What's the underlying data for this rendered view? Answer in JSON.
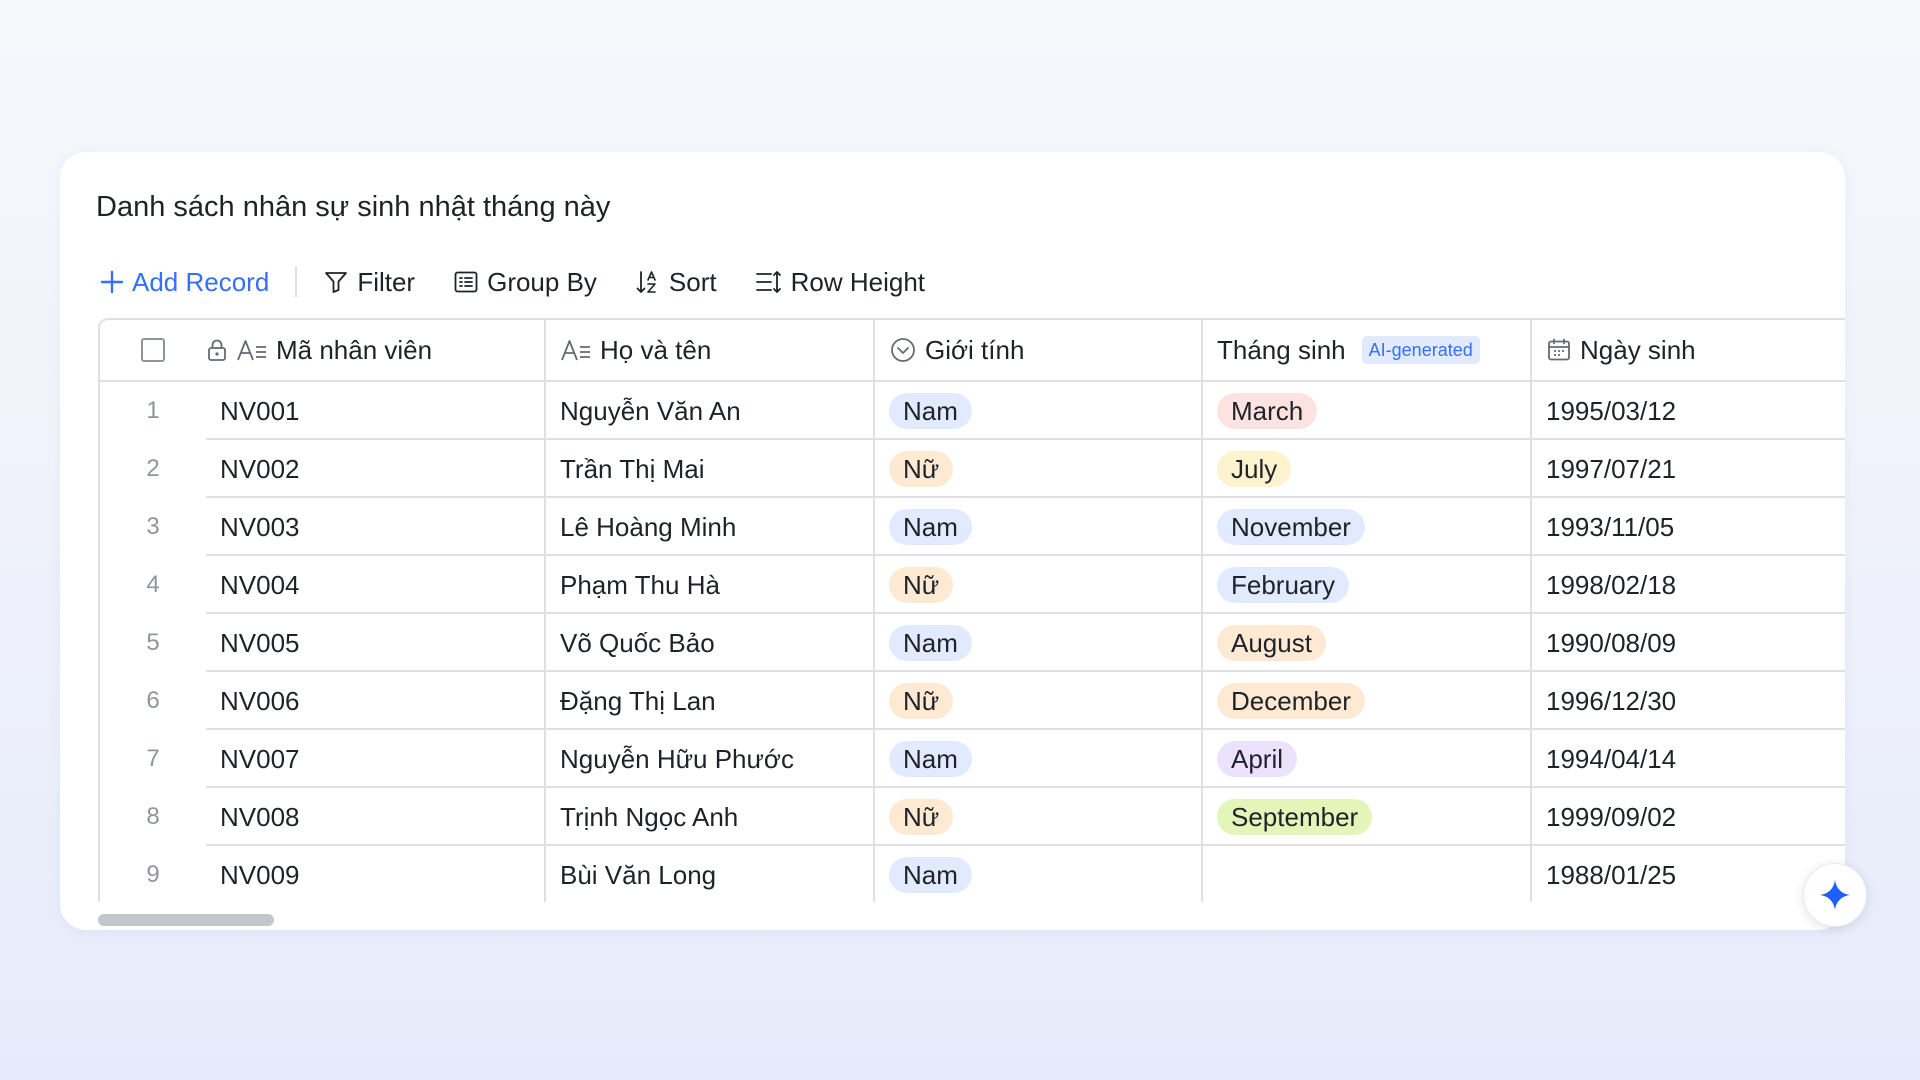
{
  "title": "Danh sách nhân sự sinh nhật tháng này",
  "toolbar": {
    "add_record": "Add Record",
    "filter": "Filter",
    "group_by": "Group By",
    "sort": "Sort",
    "row_height": "Row Height"
  },
  "columns": {
    "code": "Mã nhân viên",
    "name": "Họ và tên",
    "gender": "Giới tính",
    "month": "Tháng sinh",
    "month_badge": "AI-generated",
    "date": "Ngày sinh"
  },
  "rows": [
    {
      "num": "1",
      "code": "NV001",
      "name": "Nguyễn Văn An",
      "gender": "Nam",
      "month": "March",
      "date": "1995/03/12"
    },
    {
      "num": "2",
      "code": "NV002",
      "name": "Trần Thị Mai",
      "gender": "Nữ",
      "month": "July",
      "date": "1997/07/21"
    },
    {
      "num": "3",
      "code": "NV003",
      "name": "Lê Hoàng Minh",
      "gender": "Nam",
      "month": "November",
      "date": "1993/11/05"
    },
    {
      "num": "4",
      "code": "NV004",
      "name": "Phạm Thu Hà",
      "gender": "Nữ",
      "month": "February",
      "date": "1998/02/18"
    },
    {
      "num": "5",
      "code": "NV005",
      "name": "Võ Quốc Bảo",
      "gender": "Nam",
      "month": "August",
      "date": "1990/08/09"
    },
    {
      "num": "6",
      "code": "NV006",
      "name": "Đặng Thị Lan",
      "gender": "Nữ",
      "month": "December",
      "date": "1996/12/30"
    },
    {
      "num": "7",
      "code": "NV007",
      "name": "Nguyễn Hữu Phước",
      "gender": "Nam",
      "month": "April",
      "date": "1994/04/14"
    },
    {
      "num": "8",
      "code": "NV008",
      "name": "Trịnh Ngọc Anh",
      "gender": "Nữ",
      "month": "September",
      "date": "1999/09/02"
    },
    {
      "num": "9",
      "code": "NV009",
      "name": "Bùi Văn Long",
      "gender": "Nam",
      "month": "",
      "date": "1988/01/25"
    }
  ],
  "colors": {
    "accent": "#3370ff",
    "gender_nam": "#e1eaff",
    "gender_nu": "#feead2",
    "month_march": "#fde2e2",
    "month_july": "#fdf3cf",
    "month_november": "#e1eaff",
    "month_february": "#e1eaff",
    "month_august": "#feead2",
    "month_december": "#feead2",
    "month_april": "#ece2fe",
    "month_september": "#e4f5b8"
  },
  "icons": {
    "lock": "lock-icon",
    "text_field": "text-field-icon",
    "single_select": "single-select-icon",
    "calendar": "calendar-icon",
    "ai_assistant": "sparkle-icon"
  }
}
